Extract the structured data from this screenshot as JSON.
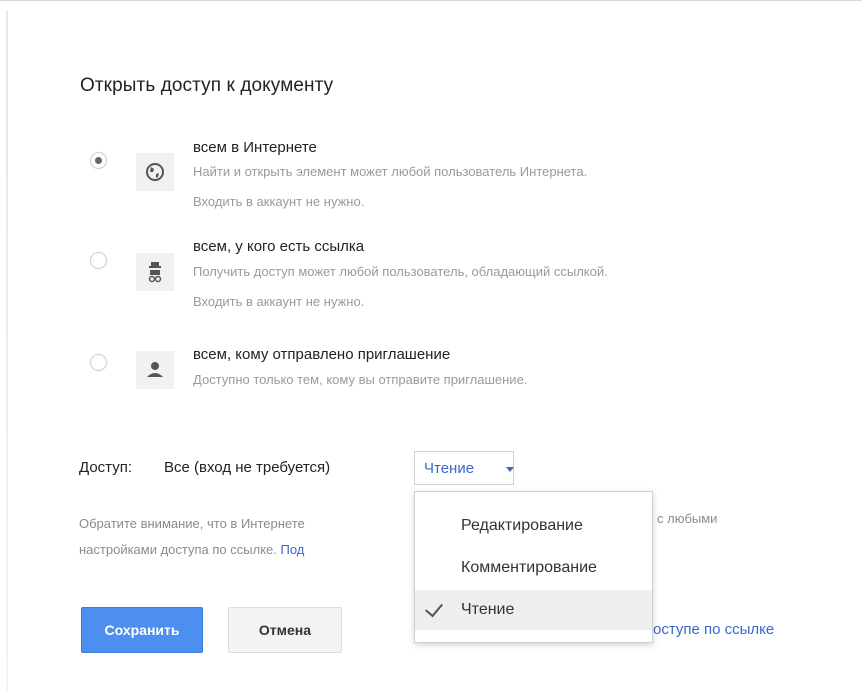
{
  "dialog": {
    "title": "Открыть доступ к документу"
  },
  "options": [
    {
      "title": "всем в Интернете",
      "desc1": "Найти и открыть элемент может любой пользователь Интернета.",
      "desc2": "Входить в аккаунт не нужно.",
      "icon": "globe-icon",
      "checked": true
    },
    {
      "title": "всем, у кого есть ссылка",
      "desc1": "Получить доступ может любой пользователь, обладающий ссылкой.",
      "desc2": "Входить в аккаунт не нужно.",
      "icon": "incognito-person-icon",
      "checked": false
    },
    {
      "title": "всем, кому отправлено приглашение",
      "desc1": "Доступно только тем, кому вы отправите приглашение.",
      "icon": "person-icon",
      "checked": false
    }
  ],
  "access": {
    "label": "Доступ:",
    "value": "Все (вход не требуется)",
    "selected": "Чтение"
  },
  "dropdown": {
    "items": [
      "Редактирование",
      "Комментирование",
      "Чтение"
    ],
    "selected_index": 2
  },
  "note": {
    "line1_left": "Обратите внимание, что в Интернете",
    "line1_right": "с любыми",
    "line2": "настройками доступа по ссылке.",
    "line2_link": "Под"
  },
  "buttons": {
    "save": "Сохранить",
    "cancel": "Отмена"
  },
  "bottom_link": "оступе по ссылке",
  "colors": {
    "accent": "#4d8ff0",
    "link": "#3a68c9"
  }
}
